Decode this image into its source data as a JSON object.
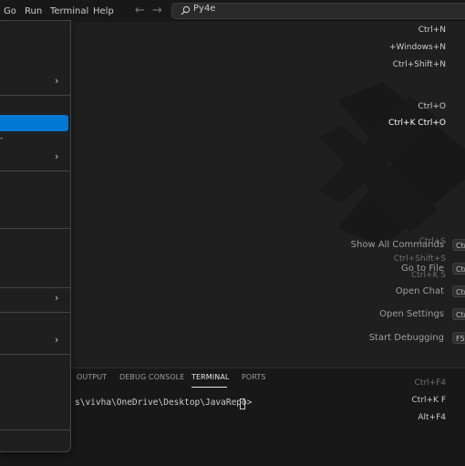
{
  "menubar": {
    "items": [
      "Go",
      "Run",
      "Terminal",
      "Help"
    ],
    "back_arrow": "←",
    "forward_arrow": "→"
  },
  "search": {
    "text": "Py4e",
    "icon": "search-icon"
  },
  "welcome_shortcuts": [
    {
      "label": "Show All Commands",
      "key": "Ctrl"
    },
    {
      "label": "Go to File",
      "key": "Ctrl"
    },
    {
      "label": "Open Chat",
      "key": "Ctrl"
    },
    {
      "label": "Open Settings",
      "key": "Ctrl"
    },
    {
      "label": "Start Debugging",
      "key": "F5"
    }
  ],
  "panel": {
    "tabs": [
      "OUTPUT",
      "DEBUG CONSOLE",
      "TERMINAL",
      "PORTS"
    ],
    "active_tab": "TERMINAL",
    "terminal_prompt": "s\\vivha\\OneDrive\\Desktop\\JavaRepo>"
  },
  "file_menu": {
    "items": [
      "Ctrl+N",
      "+Windows+N",
      "Ctrl+Shift+N",
      "›",
      "Ctrl+O",
      "Ctrl+K Ctrl+O",
      "-",
      "›",
      "Ctrl+S",
      "Ctrl+Shift+S",
      "Ctrl+K S",
      "›",
      "›",
      "Ctrl+F4",
      "Ctrl+K F",
      "Alt+F4"
    ]
  },
  "colors": {
    "accent": "#0078d4",
    "background": "#1f1f1f",
    "titlebar": "#181818",
    "text": "#cccccc"
  }
}
